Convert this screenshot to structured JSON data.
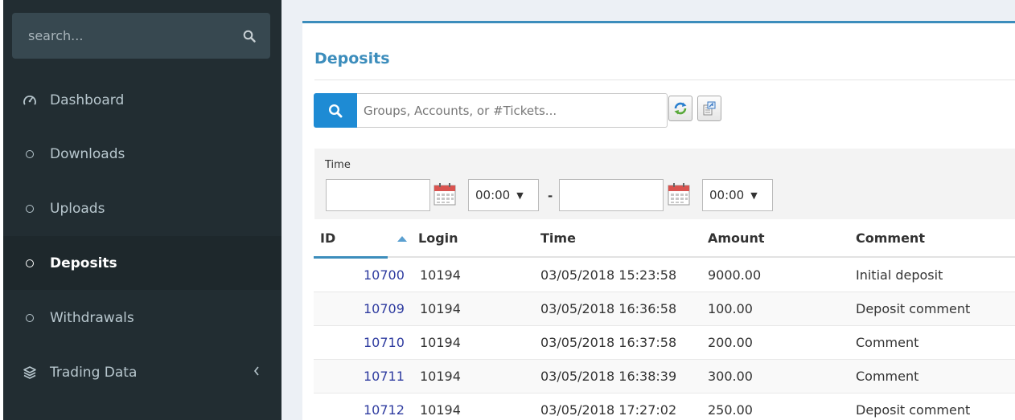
{
  "sidebar": {
    "search": {
      "placeholder": "search..."
    },
    "items": [
      {
        "label": "Dashboard",
        "icon": "dashboard-icon",
        "active": false
      },
      {
        "label": "Downloads",
        "icon": "circle-icon",
        "active": false
      },
      {
        "label": "Uploads",
        "icon": "circle-icon",
        "active": false
      },
      {
        "label": "Deposits",
        "icon": "circle-icon",
        "active": true
      },
      {
        "label": "Withdrawals",
        "icon": "circle-icon",
        "active": false
      },
      {
        "label": "Trading Data",
        "icon": "layers-icon",
        "active": false,
        "has_submenu": true
      }
    ]
  },
  "main": {
    "title": "Deposits",
    "filter": {
      "placeholder": "Groups, Accounts, or #Tickets...",
      "value": ""
    },
    "time_filter": {
      "label": "Time",
      "from_date": "",
      "from_time": "00:00",
      "separator": "-",
      "to_date": "",
      "to_time": "00:00"
    },
    "table": {
      "columns": [
        "ID",
        "Login",
        "Time",
        "Amount",
        "Comment"
      ],
      "sorted_column": "ID",
      "sort_direction": "asc",
      "rows": [
        {
          "id": "10700",
          "login": "10194",
          "time": "03/05/2018 15:23:58",
          "amount": "9000.00",
          "comment": "Initial deposit"
        },
        {
          "id": "10709",
          "login": "10194",
          "time": "03/05/2018 16:36:58",
          "amount": "100.00",
          "comment": "Deposit comment"
        },
        {
          "id": "10710",
          "login": "10194",
          "time": "03/05/2018 16:37:58",
          "amount": "200.00",
          "comment": "Comment"
        },
        {
          "id": "10711",
          "login": "10194",
          "time": "03/05/2018 16:38:39",
          "amount": "300.00",
          "comment": "Comment"
        },
        {
          "id": "10712",
          "login": "10194",
          "time": "03/05/2018 17:27:02",
          "amount": "250.00",
          "comment": "Deposit comment"
        }
      ]
    }
  },
  "colors": {
    "sidebar_bg": "#222d32",
    "sidebar_active_bg": "#1e282c",
    "accent": "#3c8dbc",
    "search_button": "#1e8bd4",
    "link": "#2f3ca0"
  }
}
